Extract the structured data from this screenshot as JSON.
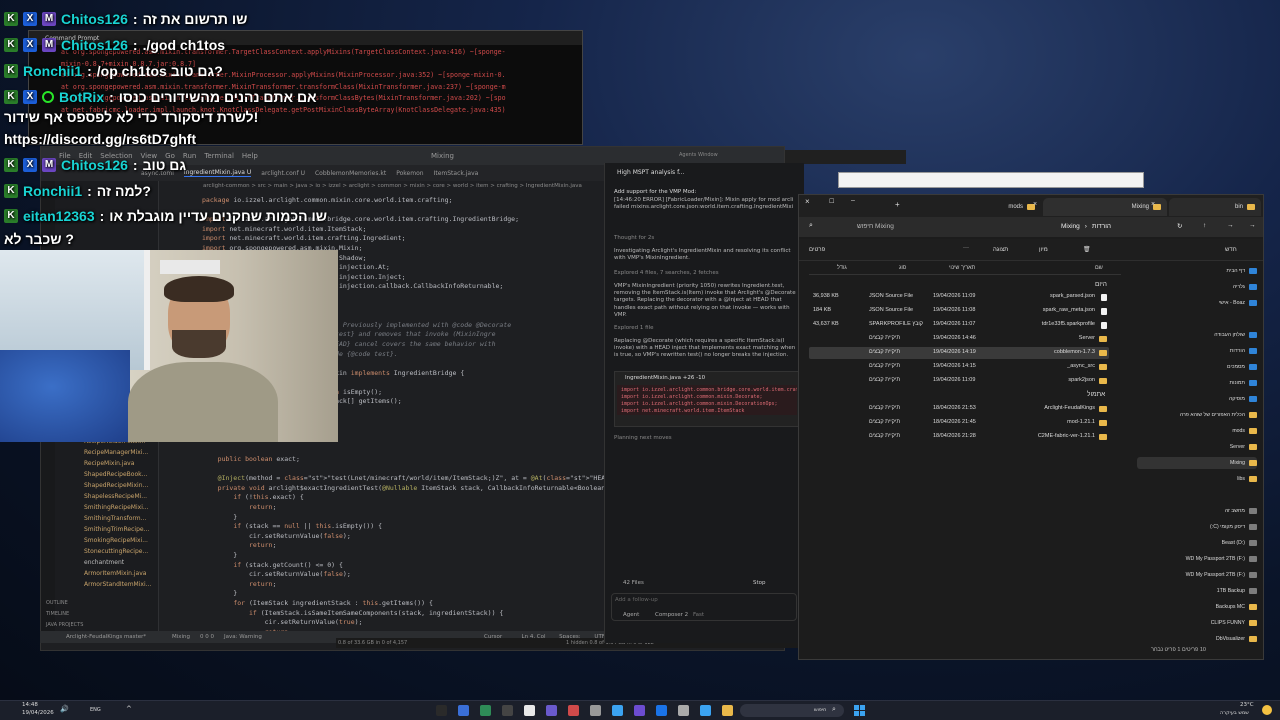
{
  "chat": [
    {
      "name": "Chitos126",
      "message": "שו תרשום את זה",
      "badges": [
        "K",
        "X",
        "M"
      ]
    },
    {
      "name": "Chitos126",
      "message": "./god ch1tos",
      "badges": [
        "K",
        "X",
        "M"
      ]
    },
    {
      "name": "Ronchii1",
      "message": "/op ch1tos גם טוב?",
      "badges": [
        "K"
      ]
    },
    {
      "name": "BotRix",
      "message": "אם אתם נהנים מהשידורים כנסו",
      "badges": [
        "K",
        "X",
        "C"
      ]
    },
    {
      "name": "",
      "message": "לשרת דיסקורד כדי לא לפספס אף שידור!",
      "badges": []
    },
    {
      "name": "",
      "message": "https://discord.gg/rs6tD7ghft",
      "badges": []
    },
    {
      "name": "Chitos126",
      "message": "גם טוב",
      "badges": [
        "K",
        "X",
        "M"
      ]
    },
    {
      "name": "Ronchii1",
      "message": "למה זה?",
      "badges": [
        "K"
      ]
    },
    {
      "name": "eitan12363",
      "message": "שו הכמות שחקנים עדיין מוגבלת או",
      "badges": [
        "K"
      ]
    },
    {
      "name": "",
      "message": "שכבר לא ?",
      "badges": []
    }
  ],
  "console": {
    "title": "Command Prompt",
    "lines": [
      "at org.spongepowered.asm.mixin.transformer.TargetClassContext.applyMixins(TargetClassContext.java:416) ~[sponge-",
      "mixin-0.8.7+mixin.0.8.7.jar:0.8.7]",
      "at org.spongepowered.asm.mixin.transformer.MixinProcessor.applyMixins(MixinProcessor.java:352) ~[sponge-mixin-0.",
      "at org.spongepowered.asm.mixin.transformer.MixinTransformer.transformClass(MixinTransformer.java:237) ~[sponge-m",
      "at org.spongepowered.asm.mixin.transformer.MixinTransformer.transformClassBytes(MixinTransformer.java:202) ~[spo",
      "at net.fabricmc.loader.impl.launch.knot.KnotClassDelegate.getPostMixinClassByteArray(KnotClassDelegate.java:435)"
    ]
  },
  "ide": {
    "menu": [
      "File",
      "Edit",
      "Selection",
      "View",
      "Go",
      "Run",
      "Terminal",
      "Help"
    ],
    "window_title": "Mixing",
    "tabs": [
      "async.toml",
      "IngredientMixin.java U",
      "arclight.conf U",
      "CobblemonMemories.kt",
      "Pokemon",
      "ItemStack.java"
    ],
    "breadcrumb": "arclight-common > src > main > java > io > izzel > arclight > common > mixin > core > world > item > crafting > IngredientMixin.java",
    "code": [
      "package io.izzel.arclight.common.mixin.core.world.item.crafting;",
      "",
      "import io.izzel.arclight.common.bridge.core.world.item.crafting.IngredientBridge;",
      "import net.minecraft.world.item.ItemStack;",
      "import net.minecraft.world.item.crafting.Ingredient;",
      "import org.spongepowered.asm.mixin.Mixin;",
      "import org.spongepowered.asm.mixin.Shadow;",
      "import org.spongepowered.asm.mixin.injection.At;",
      "import org.spongepowered.asm.mixin.injection.Inject;",
      "import org.spongepowered.asm.mixin.injection.callback.CallbackInfoReturnable;",
      "",
      "",
      "",
      "// Bukkit: component-wise matching. Previously implemented with @code @Decorate",
      "// VMP rewrites {@link Ingredient#test} and removes that invoke (MixinIngre",
      "// decorator injection. A {@code HEAD} cancel covers the same behavior with",
      "// fall back to vanilla shape inside {@code test}.",
      "",
      "public abstract class IngredientMixin implements IngredientBridge {",
      "",
      "    @Shadow public abstract boolean isEmpty();",
      "    @Shadow public abstract ItemStack[] getItems();",
      "",
      "",
      "",
      "",
      "",
      "    public boolean exact;",
      "",
      "    @Inject(method = \"test(Lnet/minecraft/world/item/ItemStack;)Z\", at = @At(\"HEAD\"), cancellable = true)",
      "    private void arclight$exactIngredientTest(@Nullable ItemStack stack, CallbackInfoReturnable<Boolean",
      "        if (!this.exact) {",
      "            return;",
      "        }",
      "        if (stack == null || this.isEmpty()) {",
      "            cir.setReturnValue(false);",
      "            return;",
      "        }",
      "        if (stack.getCount() <= 0) {",
      "            cir.setReturnValue(false);",
      "            return;",
      "        }",
      "        for (ItemStack ingredientStack : this.getItems()) {",
      "            if (ItemStack.isSameItemSameComponents(stack, ingredientStack)) {",
      "                cir.setReturnValue(true);",
      "                return;"
    ],
    "line_numbers": [
      "4",
      "5",
      "",
      "",
      "",
      "",
      "",
      "",
      "",
      "",
      "",
      "",
      "",
      "",
      "",
      "",
      "",
      "",
      "",
      "",
      "",
      "",
      "",
      "",
      "",
      "",
      "",
      "",
      "",
      ""
    ],
    "tree_items": [
      "RecipeHolderMixin...",
      "RecipeManagerMixi...",
      "RecipeMixin.java",
      "ShapedRecipeBook...",
      "ShapedRecipeMixin...",
      "ShapelessRecipeMi...",
      "SmithingRecipeMixi...",
      "SmithingTransform...",
      "SmithingTrimRecipe...",
      "SmokingRecipeMixi...",
      "StonecuttingRecipe...",
      "enchantment",
      "ArmorItemMixin.java",
      "ArmorStandItemMixi..."
    ],
    "outline_sections": [
      "OUTLINE",
      "TIMELINE",
      "JAVA PROJECTS"
    ],
    "status_left": "Arclight-FeudalKings  master*",
    "status_items": [
      "Mixing",
      "0 0 0",
      "Java: Warning"
    ],
    "status_right": [
      "Cursor Tab",
      "Ln 4, Col 1",
      "Spaces: 4",
      "UTF-8",
      "CRLF",
      "Java",
      "Go Live",
      "Automatic",
      "Chinese (Simplified)"
    ],
    "bottom_bar": "0.8 of 33.6 GB in 0 of 4,157",
    "bottom_bar2": "1 hidden  0.8 of 1.34 GB in 0 of 122"
  },
  "agent": {
    "header": "High MSPT analysis f...",
    "title": "Agents Window",
    "intro": "Add support for the VMP Mod:",
    "error": "[14:46:20 ERROR] [FabricLoader/Mixin]: Mixin apply for mod arcli failed mixins.arclight.core.json:world.item.crafting.IngredientMixi",
    "thought": "Thought for 2s",
    "p1": "Investigating Arclight's IngredientMixin and resolving its conflict with VMP's MixinIngredient.",
    "explored1": "Explored 4 files, 7 searches, 2 fetches",
    "p2": "VMP's MixinIngredient (priority 1050) rewrites Ingredient.test, removing the ItemStack.is(Item) invoke that Arclight's @Decorate targets. Replacing the decorator with a @Inject at HEAD that handles exact path without relying on that invoke — works with VMP.",
    "explored2": "Explored 1 file",
    "p3": "Replacing @Decorate (which requires a specific ItemStack.is(I invoke) with a HEAD inject that implements exact matching when is true, so VMP's rewritten test() no longer breaks the injection.",
    "diff_file": "IngredientMixin.java  +26 -10",
    "diff_lines": [
      "import io.izzel.arclight.common.bridge.core.world.item.crafting",
      "import io.izzel.arclight.common.mixin.Decorate;",
      "import io.izzel.arclight.common.mixin.DecorationOps;",
      "import net.minecraft.world.item.ItemStack"
    ],
    "planning": "Planning next moves",
    "files": "42 Files",
    "stop": "Stop",
    "followup": "Add a follow-up",
    "agent_label": "Agent",
    "model": "Composer 2",
    "model_mode": "Fast"
  },
  "explorer": {
    "tabs": [
      "bin",
      "Mixing",
      "mods"
    ],
    "path": [
      "הורדות",
      "Mixing"
    ],
    "search_placeholder": "חיפוש Mixing",
    "toolbar": [
      "חדש",
      "מיון",
      "תצוגה",
      "פרטים"
    ],
    "columns": {
      "name": "שם",
      "date": "תאריך שינוי",
      "type": "סוג",
      "size": "גודל"
    },
    "group_today": "היום",
    "group_earlier": "אתמול",
    "files": [
      {
        "name": "spark_parsed.json",
        "date": "19/04/2026 11:09",
        "type": "JSON Source File",
        "size": "36,938 KB",
        "icon": "file-icon"
      },
      {
        "name": "spark_raw_meta.json",
        "date": "19/04/2026 11:08",
        "type": "JSON Source File",
        "size": "184 KB",
        "icon": "file-icon"
      },
      {
        "name": "tdr1e33f5.sparkprofile",
        "date": "19/04/2026 11:07",
        "type": "SPARKPROFILE קובץ",
        "size": "43,637 KB",
        "icon": "file-icon"
      },
      {
        "name": "Server",
        "date": "19/04/2026 14:46",
        "type": "תיקיית קבצים",
        "size": "",
        "icon": "folder-icon"
      },
      {
        "name": "cobblemon-1.7.3",
        "date": "19/04/2026 14:19",
        "type": "תיקיית קבצים",
        "size": "",
        "icon": "folder-icon"
      },
      {
        "name": "_async_src",
        "date": "19/04/2026 14:15",
        "type": "תיקיית קבצים",
        "size": "",
        "icon": "folder-icon"
      },
      {
        "name": "spark2json",
        "date": "19/04/2026 11:09",
        "type": "תיקיית קבצים",
        "size": "",
        "icon": "folder-icon"
      },
      {
        "name": "Arclight-FeudalKings",
        "date": "18/04/2026 21:53",
        "type": "תיקיית קבצים",
        "size": "",
        "icon": "folder-icon"
      },
      {
        "name": "mod-1.21.1",
        "date": "18/04/2026 21:45",
        "type": "תיקיית קבצים",
        "size": "",
        "icon": "folder-icon"
      },
      {
        "name": "C2ME-fabric-ver-1.21.1",
        "date": "18/04/2026 21:28",
        "type": "תיקיית קבצים",
        "size": "",
        "icon": "folder-icon"
      }
    ],
    "sidebar": [
      {
        "label": "דף הבית",
        "icon": "home-icon"
      },
      {
        "label": "גלריה",
        "icon": "gallery-icon"
      },
      {
        "label": "Boaz - אישי",
        "icon": "cloud-icon"
      },
      {
        "label": "שולחן העבודה",
        "icon": "desktop-icon"
      },
      {
        "label": "הורדות",
        "icon": "download-icon"
      },
      {
        "label": "מסמכים",
        "icon": "documents-icon"
      },
      {
        "label": "תמונות",
        "icon": "pictures-icon"
      },
      {
        "label": "מוסיקה",
        "icon": "music-icon"
      },
      {
        "label": "הכלית האפורים של שוהא פרה",
        "icon": "folder-icon"
      },
      {
        "label": "mods",
        "icon": "folder-icon"
      },
      {
        "label": "Server",
        "icon": "folder-icon"
      },
      {
        "label": "Mixing",
        "icon": "folder-icon"
      },
      {
        "label": "libs",
        "icon": "folder-icon"
      },
      {
        "label": "מחשב זה",
        "icon": "pc-icon"
      },
      {
        "label": "דיסק מקומי (C:)",
        "icon": "drive-icon"
      },
      {
        "label": "Beast (D:)",
        "icon": "drive-icon"
      },
      {
        "label": "WD My Passport 2TB (F:)",
        "icon": "drive-icon"
      },
      {
        "label": "WD My Passport 2TB (F:)",
        "icon": "drive-icon"
      },
      {
        "label": "1TB Backup",
        "icon": "drive-icon"
      },
      {
        "label": "Backups MC",
        "icon": "folder-icon"
      },
      {
        "label": "CLIPS FUNNY",
        "icon": "folder-icon"
      },
      {
        "label": "DbVisualizer",
        "icon": "folder-icon"
      }
    ],
    "status": "10 פריטים  1 פריט נבחר"
  },
  "taskbar": {
    "time": "14:48",
    "date": "19/04/2026",
    "lang": "ENG",
    "search": "חיפוש",
    "weather_temp": "23°C",
    "weather_desc": "שמש בעיקרה"
  },
  "colors": {
    "accent": "#3574f0",
    "folder": "#e9b84a",
    "chat_name": "#19d3d3"
  }
}
